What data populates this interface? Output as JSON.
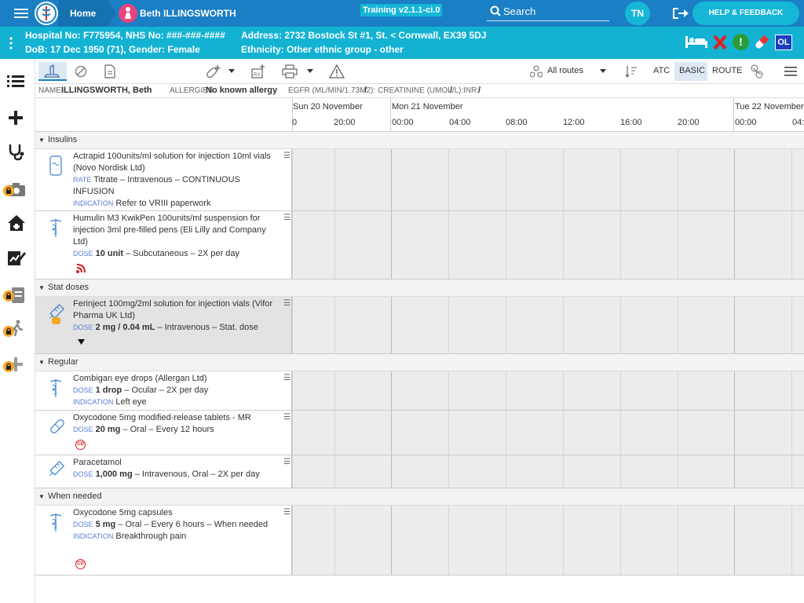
{
  "topbar": {
    "home_label": "Home",
    "patient_name": "Beth ILLINGSWORTH",
    "version": "Training v2.1.1-ci.0",
    "search_label": "Search",
    "user_initials": "TN",
    "help_label": "HELP & FEEDBACK"
  },
  "patient": {
    "line1_left": "Hospital No: F775954, NHS No: ###-###-####",
    "line1_right": "Address: 2732 Bostock St #1, St. < Cornwall, EX39 5DJ",
    "line2_left": "DoB: 17 Dec 1950 (71), Gender: Female",
    "line2_right": "Ethnicity: Other ethnic group - other",
    "badge_ol": "OL"
  },
  "toolbar": {
    "routes_label": "All routes",
    "atc_label": "ATC",
    "basic_label": "BASIC",
    "route_label": "ROUTE"
  },
  "info": {
    "name_label": "NAME:",
    "name_value": "ILLINGSWORTH, Beth",
    "allergies_label": "ALLERGIES:",
    "allergies_value": "No known allergy",
    "egfr_label": "EGFR (ML/MIN/1.73M2):",
    "egfr_value": "/",
    "creat_label": "CREATININE (UMOL/L):",
    "creat_value": "/",
    "inr_label": "INR:",
    "inr_value": "/"
  },
  "timeline": {
    "days": [
      "Sun 20 November",
      "Mon 21 November",
      "Tue 22 November"
    ],
    "times": [
      "0",
      "20:00",
      "00:00",
      "04:00",
      "08:00",
      "12:00",
      "16:00",
      "20:00",
      "00:00",
      "04:"
    ]
  },
  "sections": {
    "insulins": "Insulins",
    "stat": "Stat doses",
    "regular": "Regular",
    "when_needed": "When needed"
  },
  "drugs": {
    "actrapid": {
      "name": "Actrapid 100units/ml solution for injection 10ml vials (Novo Nordisk Ltd)",
      "rate_label": "RATE",
      "rate_text": "Titrate – Intravenous – CONTINUOUS INFUSION",
      "ind_label": "INDICATION",
      "ind_text": "Refer to VRIII paperwork"
    },
    "humulin": {
      "name": "Humulin M3 KwikPen 100units/ml suspension for injection 3ml pre-filled pens (Eli Lilly and Company Ltd)",
      "dose_label": "DOSE",
      "dose_value": "10 unit",
      "dose_text": "– Subcutaneous – 2X per day"
    },
    "ferinject": {
      "name": "Ferinject 100mg/2ml solution for injection vials (Vifor Pharma UK Ltd)",
      "dose_label": "DOSE",
      "dose_value": "2 mg / 0.04 mL",
      "dose_text": "– Intravenous – Stat. dose"
    },
    "combigan": {
      "name": "Combigan eye drops (Allergan Ltd)",
      "dose_label": "DOSE",
      "dose_value": "1 drop",
      "dose_text": "– Ocular – 2X per day",
      "ind_label": "INDICATION",
      "ind_text": "Left eye"
    },
    "oxycodone_mr": {
      "name": "Oxycodone 5mg modified-release tablets - MR",
      "dose_label": "DOSE",
      "dose_value": "20 mg",
      "dose_text": "– Oral – Every 12 hours",
      "cd": "CD"
    },
    "paracetamol": {
      "name": "Paracetamol",
      "dose_label": "DOSE",
      "dose_value": "1,000 mg",
      "dose_text": "– Intravenous, Oral – 2X per day"
    },
    "oxycodone_caps": {
      "name": "Oxycodone 5mg capsules",
      "dose_label": "DOSE",
      "dose_value": "5 mg",
      "dose_text": "– Oral – Every 6 hours – When needed",
      "ind_label": "INDICATION",
      "ind_text": "Breakthrough pain",
      "cd": "CD"
    }
  },
  "colors": {
    "topbar": "#1a7fc4",
    "patient_bar": "#13b2d3",
    "help_button": "#15b6d6",
    "alert_red": "#e02020",
    "alert_green": "#2a9d3a",
    "ol_badge": "#1a3fbf"
  }
}
